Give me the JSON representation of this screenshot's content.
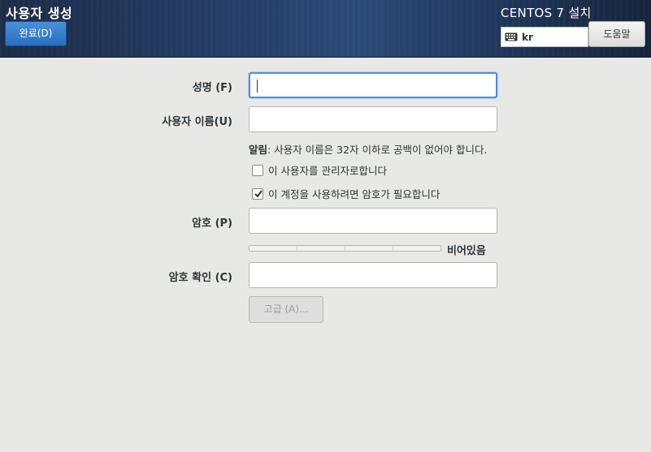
{
  "header": {
    "spoke_title": "사용자 생성",
    "done_label": "완료(D)",
    "product_title": "CENTOS 7 설치",
    "keyboard_layout": "kr",
    "help_label": "도움말"
  },
  "form": {
    "full_name": {
      "label": "성명 (F)",
      "value": ""
    },
    "username": {
      "label": "사용자 이름(U)",
      "value": ""
    },
    "note_bold": "알림",
    "note_text": ": 사용자 이름은 32자 이하로 공백이 없어야 합니다.",
    "admin_checkbox": {
      "label": "이 사용자를 관리자로합니다",
      "checked": false
    },
    "require_password_checkbox": {
      "label": "이 계정을 사용하려면 암호가 필요합니다",
      "checked": true
    },
    "password": {
      "label": "암호 (P)",
      "value": ""
    },
    "password_strength": {
      "text": "비어있음",
      "level": 0
    },
    "confirm_password": {
      "label": "암호 확인 (C)",
      "value": ""
    },
    "advanced_label": "고급 (A)..."
  },
  "colors": {
    "header_bg": "#243b63",
    "accent": "#4a90d9",
    "window_bg": "#e8e8e7"
  },
  "icons": {
    "keyboard": "keyboard-icon",
    "check": "checkmark-icon"
  }
}
